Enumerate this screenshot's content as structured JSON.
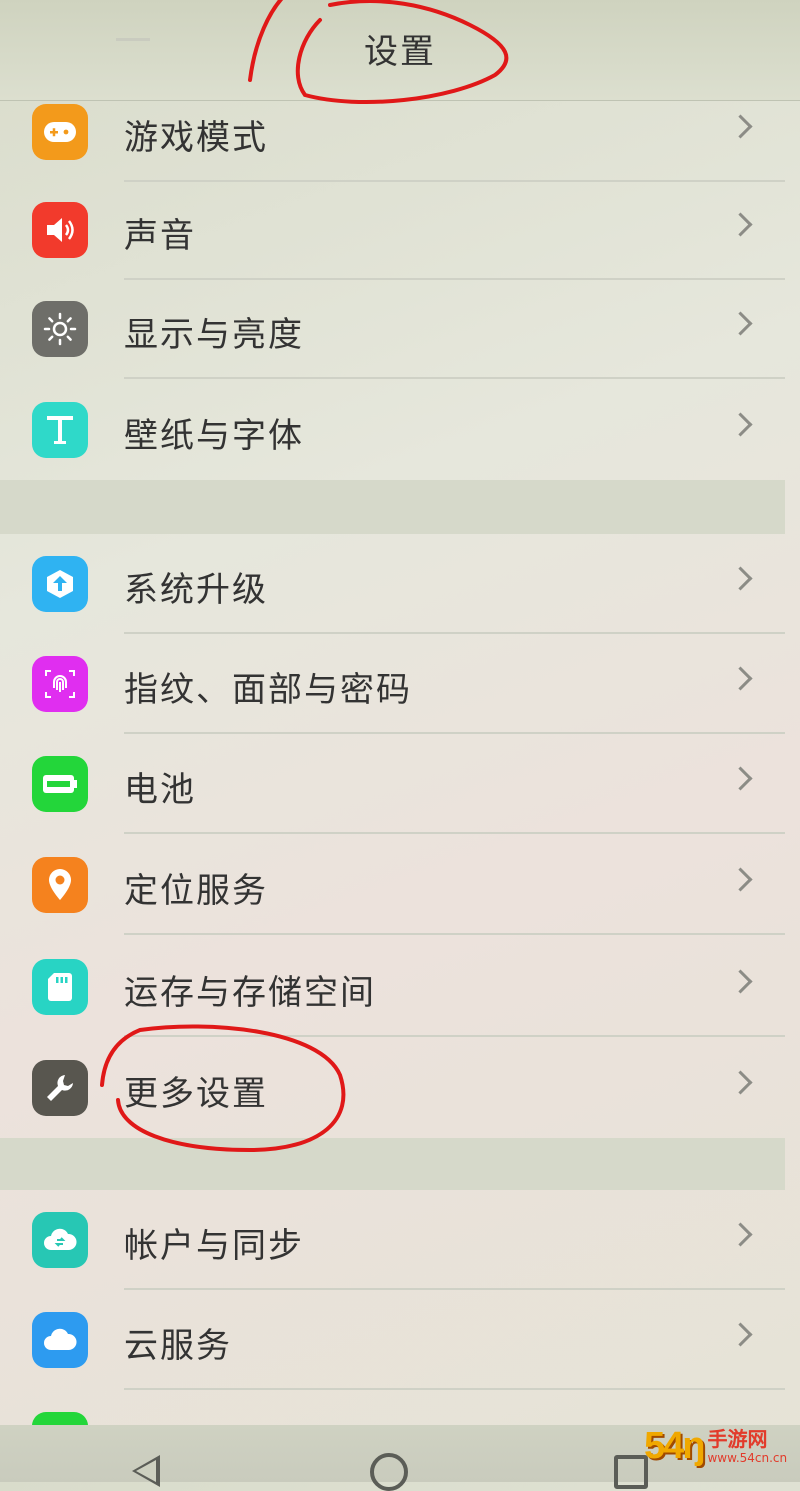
{
  "header": {
    "title": "设置"
  },
  "settings": [
    {
      "label": "游戏模式",
      "icon": "gamepad-icon",
      "color": "#f39a1b"
    },
    {
      "label": "声音",
      "icon": "speaker-icon",
      "color": "#f23a2c"
    },
    {
      "label": "显示与亮度",
      "icon": "brightness-icon",
      "color": "#6e6e69"
    },
    {
      "label": "壁纸与字体",
      "icon": "font-t-icon",
      "color": "#2fd9c9"
    },
    {
      "label": "系统升级",
      "icon": "upgrade-icon",
      "color": "#2fb3f2"
    },
    {
      "label": "指纹、面部与密码",
      "icon": "fingerprint-icon",
      "color": "#e02ef0"
    },
    {
      "label": "电池",
      "icon": "battery-icon",
      "color": "#23d63a"
    },
    {
      "label": "定位服务",
      "icon": "location-pin-icon",
      "color": "#f5821e"
    },
    {
      "label": "运存与存储空间",
      "icon": "storage-card-icon",
      "color": "#28d4c4"
    },
    {
      "label": "更多设置",
      "icon": "wrench-icon",
      "color": "#58564f"
    },
    {
      "label": "帐户与同步",
      "icon": "cloud-sync-icon",
      "color": "#27c7b4"
    },
    {
      "label": "云服务",
      "icon": "cloud-icon",
      "color": "#2d9bf0"
    }
  ],
  "navbar": {
    "buttons": [
      "back-icon",
      "home-icon",
      "recent-apps-icon"
    ]
  },
  "watermark": {
    "logo": "54ŋ",
    "name": "手游网",
    "url": "www.54cn.cn"
  }
}
